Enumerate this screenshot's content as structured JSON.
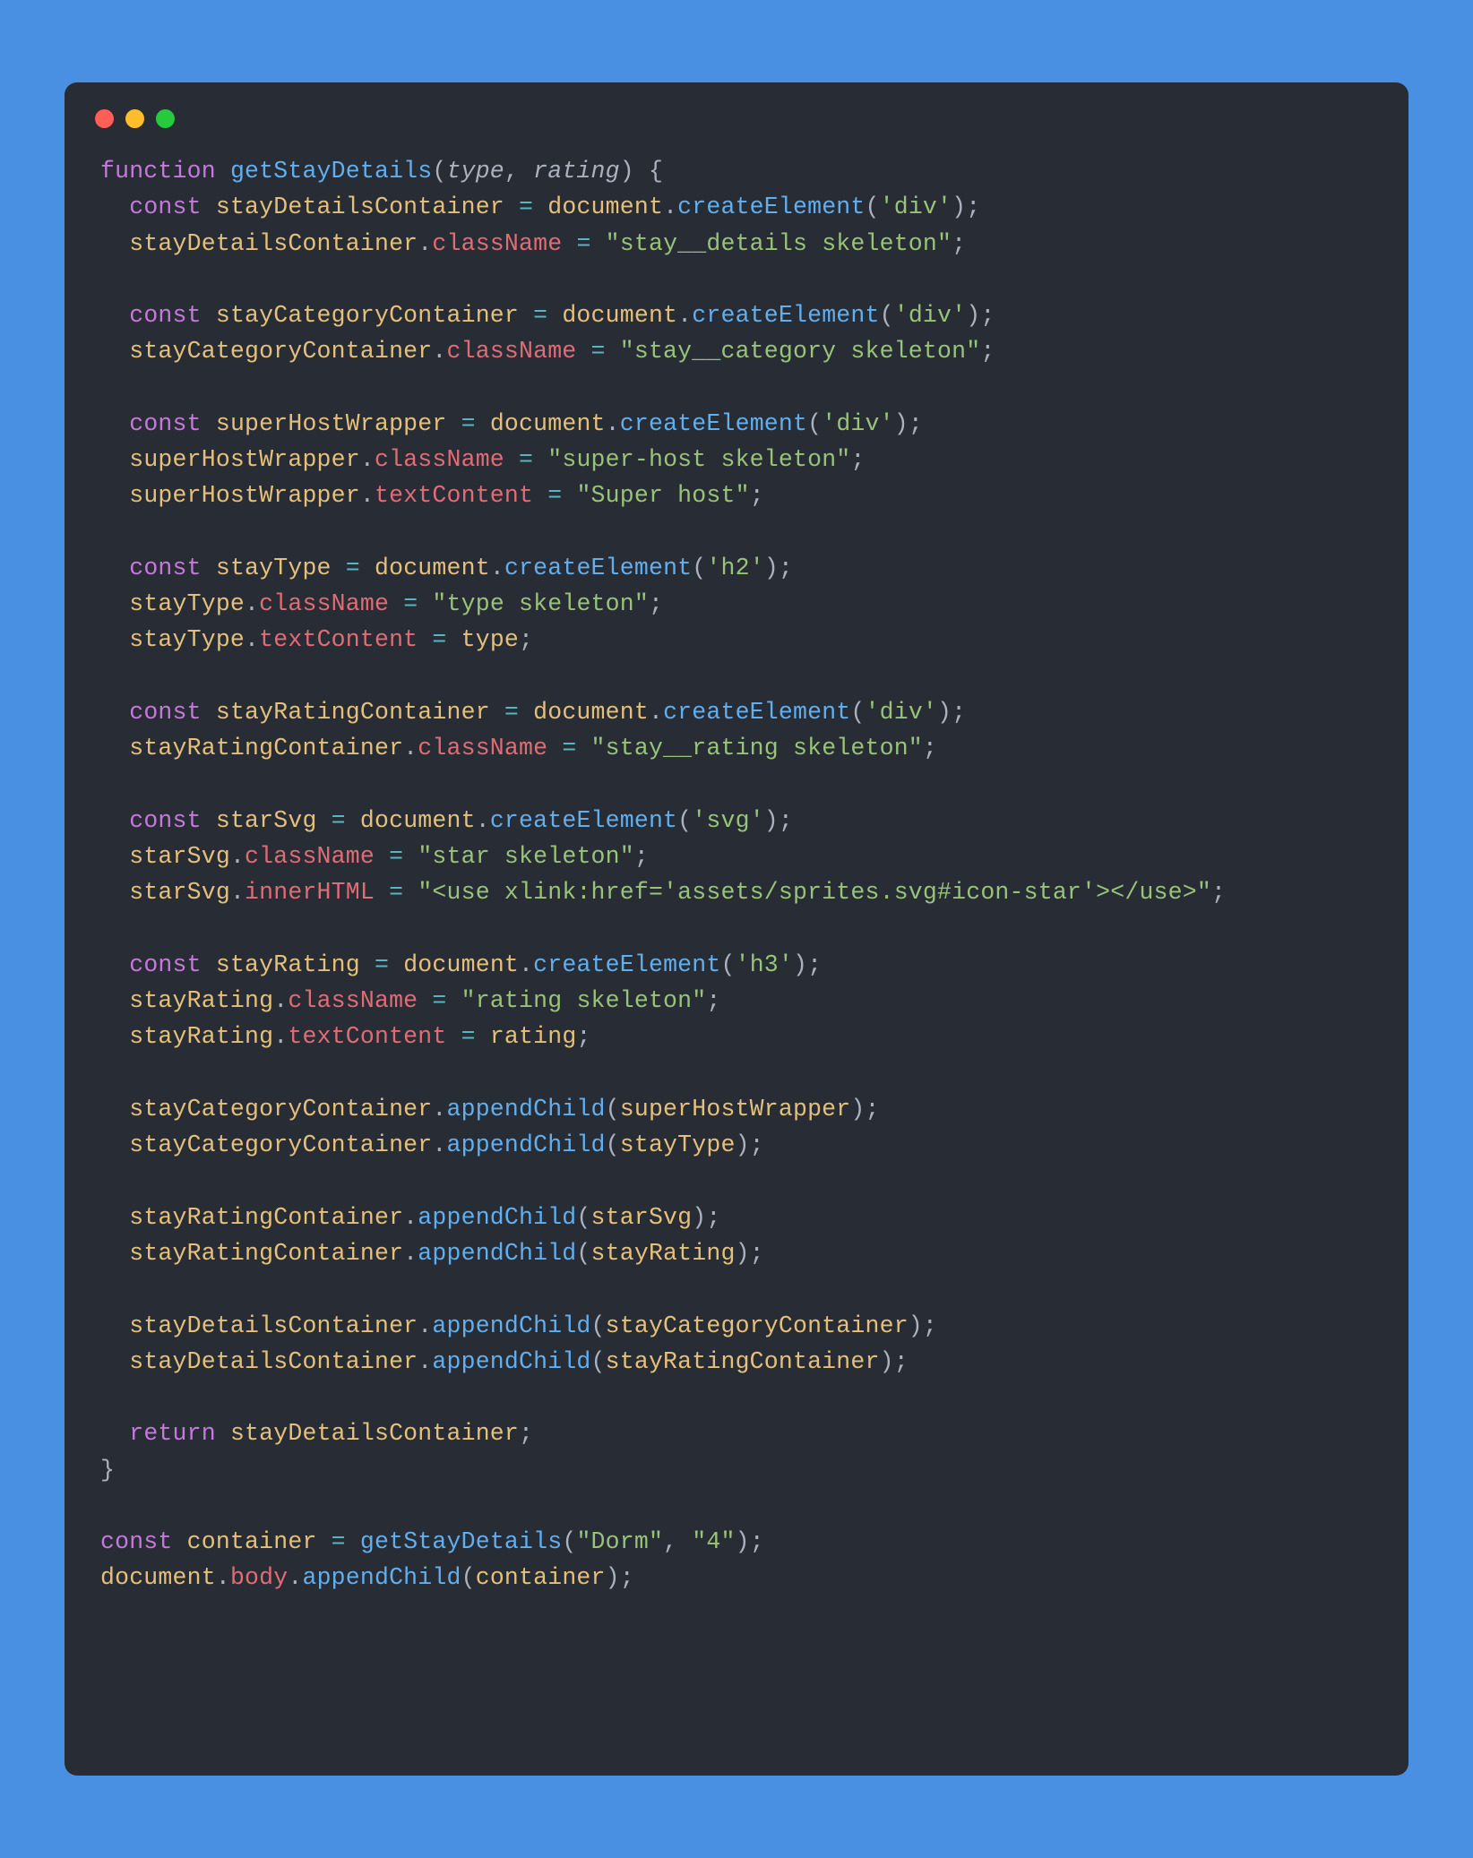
{
  "window": {
    "dots": [
      "red",
      "yellow",
      "green"
    ]
  },
  "palette": {
    "bg_page": "#4a90e2",
    "bg_editor": "#282c34",
    "text": "#abb2bf",
    "keyword": "#c678dd",
    "function": "#61afef",
    "variable": "#e5c07b",
    "property": "#e06c75",
    "string": "#98c379",
    "operator": "#56b6c2"
  },
  "code": {
    "lines": [
      [
        [
          "kw",
          "function"
        ],
        [
          "punc",
          " "
        ],
        [
          "fn",
          "getStayDetails"
        ],
        [
          "punc",
          "("
        ],
        [
          "param",
          "type"
        ],
        [
          "punc",
          ", "
        ],
        [
          "param",
          "rating"
        ],
        [
          "punc",
          ") {"
        ]
      ],
      [
        [
          "punc",
          "  "
        ],
        [
          "kw",
          "const"
        ],
        [
          "punc",
          " "
        ],
        [
          "var",
          "stayDetailsContainer"
        ],
        [
          "punc",
          " "
        ],
        [
          "op",
          "="
        ],
        [
          "punc",
          " "
        ],
        [
          "var",
          "document"
        ],
        [
          "punc",
          "."
        ],
        [
          "fn",
          "createElement"
        ],
        [
          "punc",
          "("
        ],
        [
          "str",
          "'div'"
        ],
        [
          "punc",
          ");"
        ]
      ],
      [
        [
          "punc",
          "  "
        ],
        [
          "var",
          "stayDetailsContainer"
        ],
        [
          "punc",
          "."
        ],
        [
          "prop",
          "className"
        ],
        [
          "punc",
          " "
        ],
        [
          "op",
          "="
        ],
        [
          "punc",
          " "
        ],
        [
          "str",
          "\"stay__details skeleton\""
        ],
        [
          "punc",
          ";"
        ]
      ],
      [
        [
          "punc",
          ""
        ]
      ],
      [
        [
          "punc",
          "  "
        ],
        [
          "kw",
          "const"
        ],
        [
          "punc",
          " "
        ],
        [
          "var",
          "stayCategoryContainer"
        ],
        [
          "punc",
          " "
        ],
        [
          "op",
          "="
        ],
        [
          "punc",
          " "
        ],
        [
          "var",
          "document"
        ],
        [
          "punc",
          "."
        ],
        [
          "fn",
          "createElement"
        ],
        [
          "punc",
          "("
        ],
        [
          "str",
          "'div'"
        ],
        [
          "punc",
          ");"
        ]
      ],
      [
        [
          "punc",
          "  "
        ],
        [
          "var",
          "stayCategoryContainer"
        ],
        [
          "punc",
          "."
        ],
        [
          "prop",
          "className"
        ],
        [
          "punc",
          " "
        ],
        [
          "op",
          "="
        ],
        [
          "punc",
          " "
        ],
        [
          "str",
          "\"stay__category skeleton\""
        ],
        [
          "punc",
          ";"
        ]
      ],
      [
        [
          "punc",
          ""
        ]
      ],
      [
        [
          "punc",
          "  "
        ],
        [
          "kw",
          "const"
        ],
        [
          "punc",
          " "
        ],
        [
          "var",
          "superHostWrapper"
        ],
        [
          "punc",
          " "
        ],
        [
          "op",
          "="
        ],
        [
          "punc",
          " "
        ],
        [
          "var",
          "document"
        ],
        [
          "punc",
          "."
        ],
        [
          "fn",
          "createElement"
        ],
        [
          "punc",
          "("
        ],
        [
          "str",
          "'div'"
        ],
        [
          "punc",
          ");"
        ]
      ],
      [
        [
          "punc",
          "  "
        ],
        [
          "var",
          "superHostWrapper"
        ],
        [
          "punc",
          "."
        ],
        [
          "prop",
          "className"
        ],
        [
          "punc",
          " "
        ],
        [
          "op",
          "="
        ],
        [
          "punc",
          " "
        ],
        [
          "str",
          "\"super-host skeleton\""
        ],
        [
          "punc",
          ";"
        ]
      ],
      [
        [
          "punc",
          "  "
        ],
        [
          "var",
          "superHostWrapper"
        ],
        [
          "punc",
          "."
        ],
        [
          "prop",
          "textContent"
        ],
        [
          "punc",
          " "
        ],
        [
          "op",
          "="
        ],
        [
          "punc",
          " "
        ],
        [
          "str",
          "\"Super host\""
        ],
        [
          "punc",
          ";"
        ]
      ],
      [
        [
          "punc",
          ""
        ]
      ],
      [
        [
          "punc",
          "  "
        ],
        [
          "kw",
          "const"
        ],
        [
          "punc",
          " "
        ],
        [
          "var",
          "stayType"
        ],
        [
          "punc",
          " "
        ],
        [
          "op",
          "="
        ],
        [
          "punc",
          " "
        ],
        [
          "var",
          "document"
        ],
        [
          "punc",
          "."
        ],
        [
          "fn",
          "createElement"
        ],
        [
          "punc",
          "("
        ],
        [
          "str",
          "'h2'"
        ],
        [
          "punc",
          ");"
        ]
      ],
      [
        [
          "punc",
          "  "
        ],
        [
          "var",
          "stayType"
        ],
        [
          "punc",
          "."
        ],
        [
          "prop",
          "className"
        ],
        [
          "punc",
          " "
        ],
        [
          "op",
          "="
        ],
        [
          "punc",
          " "
        ],
        [
          "str",
          "\"type skeleton\""
        ],
        [
          "punc",
          ";"
        ]
      ],
      [
        [
          "punc",
          "  "
        ],
        [
          "var",
          "stayType"
        ],
        [
          "punc",
          "."
        ],
        [
          "prop",
          "textContent"
        ],
        [
          "punc",
          " "
        ],
        [
          "op",
          "="
        ],
        [
          "punc",
          " "
        ],
        [
          "var",
          "type"
        ],
        [
          "punc",
          ";"
        ]
      ],
      [
        [
          "punc",
          ""
        ]
      ],
      [
        [
          "punc",
          "  "
        ],
        [
          "kw",
          "const"
        ],
        [
          "punc",
          " "
        ],
        [
          "var",
          "stayRatingContainer"
        ],
        [
          "punc",
          " "
        ],
        [
          "op",
          "="
        ],
        [
          "punc",
          " "
        ],
        [
          "var",
          "document"
        ],
        [
          "punc",
          "."
        ],
        [
          "fn",
          "createElement"
        ],
        [
          "punc",
          "("
        ],
        [
          "str",
          "'div'"
        ],
        [
          "punc",
          ");"
        ]
      ],
      [
        [
          "punc",
          "  "
        ],
        [
          "var",
          "stayRatingContainer"
        ],
        [
          "punc",
          "."
        ],
        [
          "prop",
          "className"
        ],
        [
          "punc",
          " "
        ],
        [
          "op",
          "="
        ],
        [
          "punc",
          " "
        ],
        [
          "str",
          "\"stay__rating skeleton\""
        ],
        [
          "punc",
          ";"
        ]
      ],
      [
        [
          "punc",
          ""
        ]
      ],
      [
        [
          "punc",
          "  "
        ],
        [
          "kw",
          "const"
        ],
        [
          "punc",
          " "
        ],
        [
          "var",
          "starSvg"
        ],
        [
          "punc",
          " "
        ],
        [
          "op",
          "="
        ],
        [
          "punc",
          " "
        ],
        [
          "var",
          "document"
        ],
        [
          "punc",
          "."
        ],
        [
          "fn",
          "createElement"
        ],
        [
          "punc",
          "("
        ],
        [
          "str",
          "'svg'"
        ],
        [
          "punc",
          ");"
        ]
      ],
      [
        [
          "punc",
          "  "
        ],
        [
          "var",
          "starSvg"
        ],
        [
          "punc",
          "."
        ],
        [
          "prop",
          "className"
        ],
        [
          "punc",
          " "
        ],
        [
          "op",
          "="
        ],
        [
          "punc",
          " "
        ],
        [
          "str",
          "\"star skeleton\""
        ],
        [
          "punc",
          ";"
        ]
      ],
      [
        [
          "punc",
          "  "
        ],
        [
          "var",
          "starSvg"
        ],
        [
          "punc",
          "."
        ],
        [
          "prop",
          "innerHTML"
        ],
        [
          "punc",
          " "
        ],
        [
          "op",
          "="
        ],
        [
          "punc",
          " "
        ],
        [
          "str",
          "\"<use xlink:href='assets/sprites.svg#icon-star'></use>\""
        ],
        [
          "punc",
          ";"
        ]
      ],
      [
        [
          "punc",
          ""
        ]
      ],
      [
        [
          "punc",
          "  "
        ],
        [
          "kw",
          "const"
        ],
        [
          "punc",
          " "
        ],
        [
          "var",
          "stayRating"
        ],
        [
          "punc",
          " "
        ],
        [
          "op",
          "="
        ],
        [
          "punc",
          " "
        ],
        [
          "var",
          "document"
        ],
        [
          "punc",
          "."
        ],
        [
          "fn",
          "createElement"
        ],
        [
          "punc",
          "("
        ],
        [
          "str",
          "'h3'"
        ],
        [
          "punc",
          ");"
        ]
      ],
      [
        [
          "punc",
          "  "
        ],
        [
          "var",
          "stayRating"
        ],
        [
          "punc",
          "."
        ],
        [
          "prop",
          "className"
        ],
        [
          "punc",
          " "
        ],
        [
          "op",
          "="
        ],
        [
          "punc",
          " "
        ],
        [
          "str",
          "\"rating skeleton\""
        ],
        [
          "punc",
          ";"
        ]
      ],
      [
        [
          "punc",
          "  "
        ],
        [
          "var",
          "stayRating"
        ],
        [
          "punc",
          "."
        ],
        [
          "prop",
          "textContent"
        ],
        [
          "punc",
          " "
        ],
        [
          "op",
          "="
        ],
        [
          "punc",
          " "
        ],
        [
          "var",
          "rating"
        ],
        [
          "punc",
          ";"
        ]
      ],
      [
        [
          "punc",
          ""
        ]
      ],
      [
        [
          "punc",
          "  "
        ],
        [
          "var",
          "stayCategoryContainer"
        ],
        [
          "punc",
          "."
        ],
        [
          "fn",
          "appendChild"
        ],
        [
          "punc",
          "("
        ],
        [
          "var",
          "superHostWrapper"
        ],
        [
          "punc",
          ");"
        ]
      ],
      [
        [
          "punc",
          "  "
        ],
        [
          "var",
          "stayCategoryContainer"
        ],
        [
          "punc",
          "."
        ],
        [
          "fn",
          "appendChild"
        ],
        [
          "punc",
          "("
        ],
        [
          "var",
          "stayType"
        ],
        [
          "punc",
          ");"
        ]
      ],
      [
        [
          "punc",
          ""
        ]
      ],
      [
        [
          "punc",
          "  "
        ],
        [
          "var",
          "stayRatingContainer"
        ],
        [
          "punc",
          "."
        ],
        [
          "fn",
          "appendChild"
        ],
        [
          "punc",
          "("
        ],
        [
          "var",
          "starSvg"
        ],
        [
          "punc",
          ");"
        ]
      ],
      [
        [
          "punc",
          "  "
        ],
        [
          "var",
          "stayRatingContainer"
        ],
        [
          "punc",
          "."
        ],
        [
          "fn",
          "appendChild"
        ],
        [
          "punc",
          "("
        ],
        [
          "var",
          "stayRating"
        ],
        [
          "punc",
          ");"
        ]
      ],
      [
        [
          "punc",
          ""
        ]
      ],
      [
        [
          "punc",
          "  "
        ],
        [
          "var",
          "stayDetailsContainer"
        ],
        [
          "punc",
          "."
        ],
        [
          "fn",
          "appendChild"
        ],
        [
          "punc",
          "("
        ],
        [
          "var",
          "stayCategoryContainer"
        ],
        [
          "punc",
          ");"
        ]
      ],
      [
        [
          "punc",
          "  "
        ],
        [
          "var",
          "stayDetailsContainer"
        ],
        [
          "punc",
          "."
        ],
        [
          "fn",
          "appendChild"
        ],
        [
          "punc",
          "("
        ],
        [
          "var",
          "stayRatingContainer"
        ],
        [
          "punc",
          ");"
        ]
      ],
      [
        [
          "punc",
          ""
        ]
      ],
      [
        [
          "punc",
          "  "
        ],
        [
          "kw",
          "return"
        ],
        [
          "punc",
          " "
        ],
        [
          "var",
          "stayDetailsContainer"
        ],
        [
          "punc",
          ";"
        ]
      ],
      [
        [
          "punc",
          "}"
        ]
      ],
      [
        [
          "punc",
          ""
        ]
      ],
      [
        [
          "kw",
          "const"
        ],
        [
          "punc",
          " "
        ],
        [
          "var",
          "container"
        ],
        [
          "punc",
          " "
        ],
        [
          "op",
          "="
        ],
        [
          "punc",
          " "
        ],
        [
          "fn",
          "getStayDetails"
        ],
        [
          "punc",
          "("
        ],
        [
          "str",
          "\"Dorm\""
        ],
        [
          "punc",
          ", "
        ],
        [
          "str",
          "\"4\""
        ],
        [
          "punc",
          ");"
        ]
      ],
      [
        [
          "var",
          "document"
        ],
        [
          "punc",
          "."
        ],
        [
          "prop",
          "body"
        ],
        [
          "punc",
          "."
        ],
        [
          "fn",
          "appendChild"
        ],
        [
          "punc",
          "("
        ],
        [
          "var",
          "container"
        ],
        [
          "punc",
          ");"
        ]
      ]
    ]
  }
}
